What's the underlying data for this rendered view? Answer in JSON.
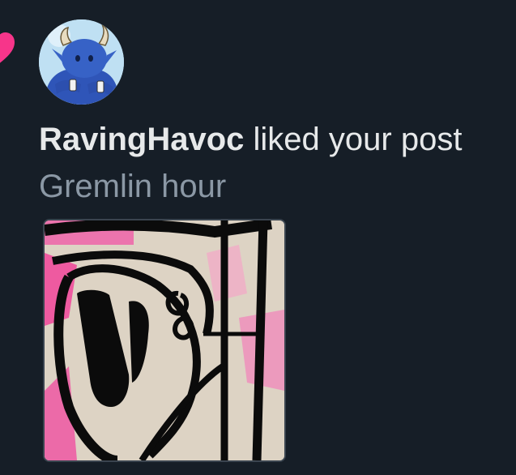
{
  "notification": {
    "type_icon": "heart-icon",
    "avatar_icon": "avatar-blue-horned-creature",
    "username": "RavingHavoc",
    "action_text": " liked your post",
    "post_text": "Gremlin hour",
    "post_image_icon": "post-image-ink-drawing"
  },
  "colors": {
    "background": "#161e27",
    "heart": "#f7358a",
    "primary_text": "#e7e9ea",
    "secondary_text": "#8b98a5"
  }
}
